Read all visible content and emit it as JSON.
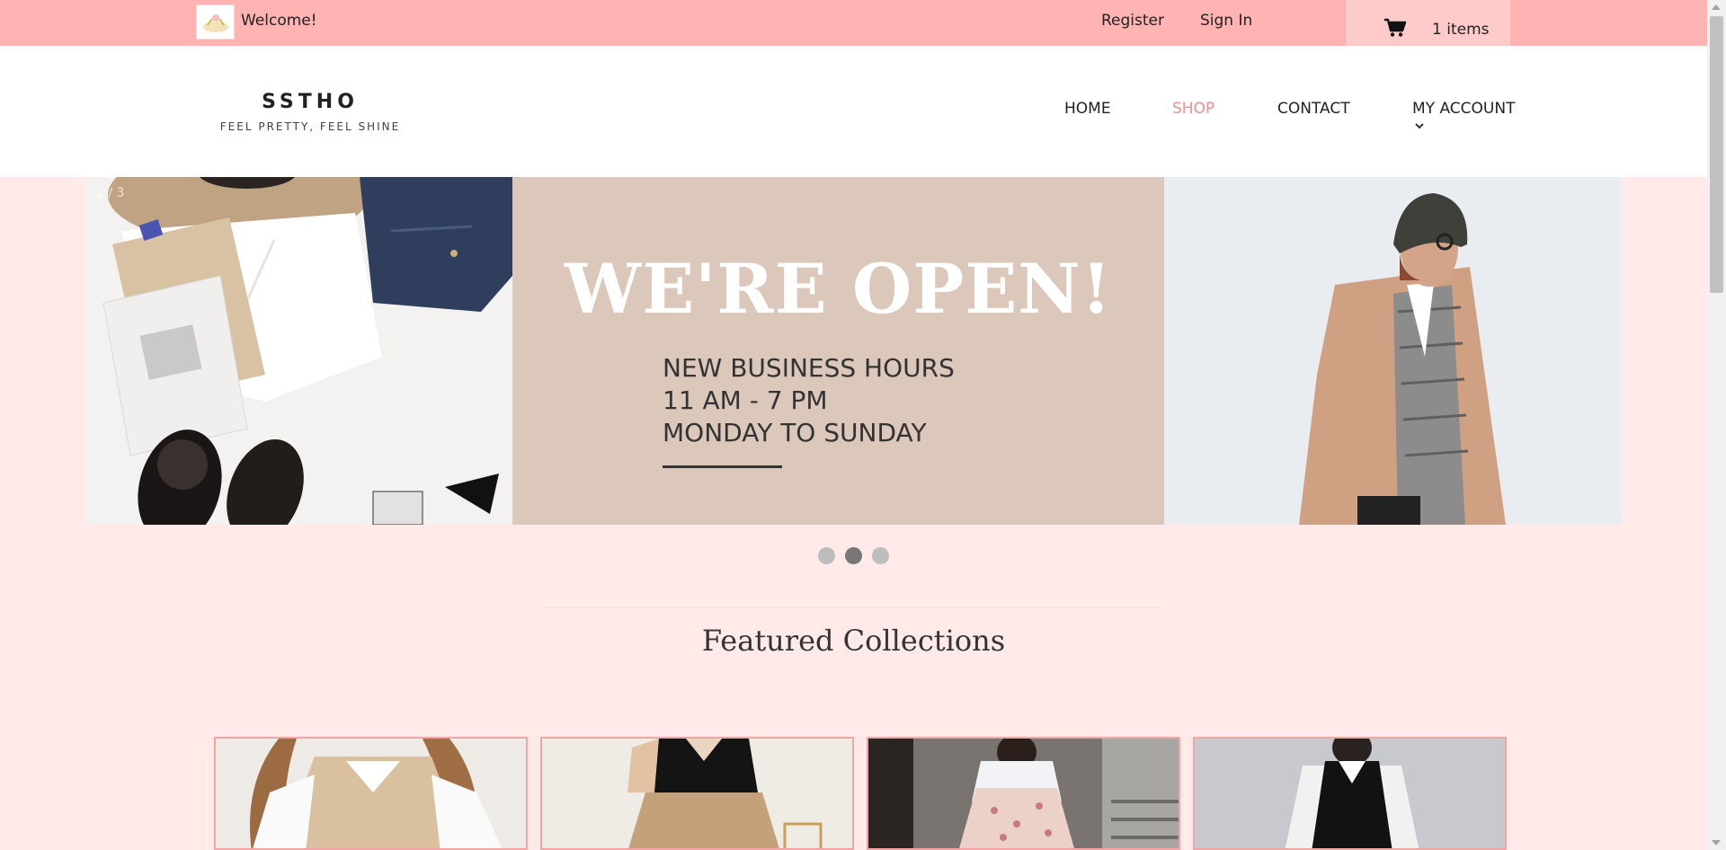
{
  "topbar": {
    "welcome": "Welcome!",
    "register": "Register",
    "sign_in": "Sign In",
    "cart_icon": "cart-icon",
    "cart_label": "1 items"
  },
  "header": {
    "brand_name": "SSTHO",
    "tagline": "FEEL PRETTY, FEEL SHINE",
    "nav": {
      "home": "HOME",
      "shop": "SHOP",
      "contact": "CONTACT",
      "account": "MY ACCOUNT"
    }
  },
  "slider": {
    "counter": "2 / 3",
    "headline": "WE'RE OPEN!",
    "hours_line1": "NEW BUSINESS HOURS",
    "hours_line2": "11 AM - 7 PM",
    "hours_line3": "MONDAY TO SUNDAY",
    "dot_count": 3,
    "active_dot": 2
  },
  "featured": {
    "title": "Featured Collections"
  },
  "colors": {
    "topbar_bg": "#ffb3b3",
    "page_bg": "#ffe9e9",
    "accent": "#f28e8e",
    "banner_bg": "#dcc7bb"
  }
}
